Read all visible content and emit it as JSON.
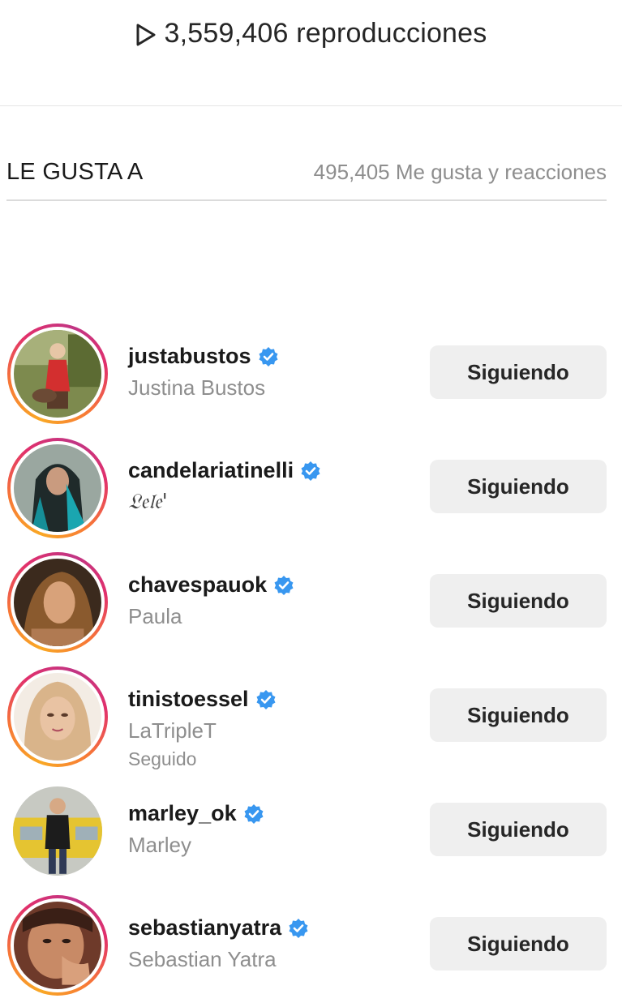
{
  "header": {
    "plays_text": "3,559,406 reproducciones",
    "play_icon": "play-outline-icon"
  },
  "likes": {
    "title": "LE GUSTA A",
    "count_text": "495,405 Me gusta y reacciones"
  },
  "colors": {
    "verified": "#3897f0",
    "button_bg": "#efefef",
    "secondary_text": "#8e8e8e",
    "story_ring_start": "#f9a825",
    "story_ring_end": "#c13584"
  },
  "users": [
    {
      "username": "justabustos",
      "full_name": "Justina Bustos",
      "subtext": "",
      "verified": true,
      "story_ring": true,
      "button": "Siguiendo"
    },
    {
      "username": "candelariatinelli",
      "full_name": "𝔏𝔢𝔩𝔢'",
      "subtext": "",
      "verified": true,
      "story_ring": true,
      "button": "Siguiendo"
    },
    {
      "username": "chavespauok",
      "full_name": "Paula",
      "subtext": "",
      "verified": true,
      "story_ring": true,
      "button": "Siguiendo"
    },
    {
      "username": "tinistoessel",
      "full_name": "LaTripleT",
      "subtext": "Seguido",
      "verified": true,
      "story_ring": true,
      "button": "Siguiendo"
    },
    {
      "username": "marley_ok",
      "full_name": "Marley",
      "subtext": "",
      "verified": true,
      "story_ring": false,
      "button": "Siguiendo"
    },
    {
      "username": "sebastianyatra",
      "full_name": "Sebastian Yatra",
      "subtext": "",
      "verified": true,
      "story_ring": true,
      "button": "Siguiendo"
    }
  ]
}
